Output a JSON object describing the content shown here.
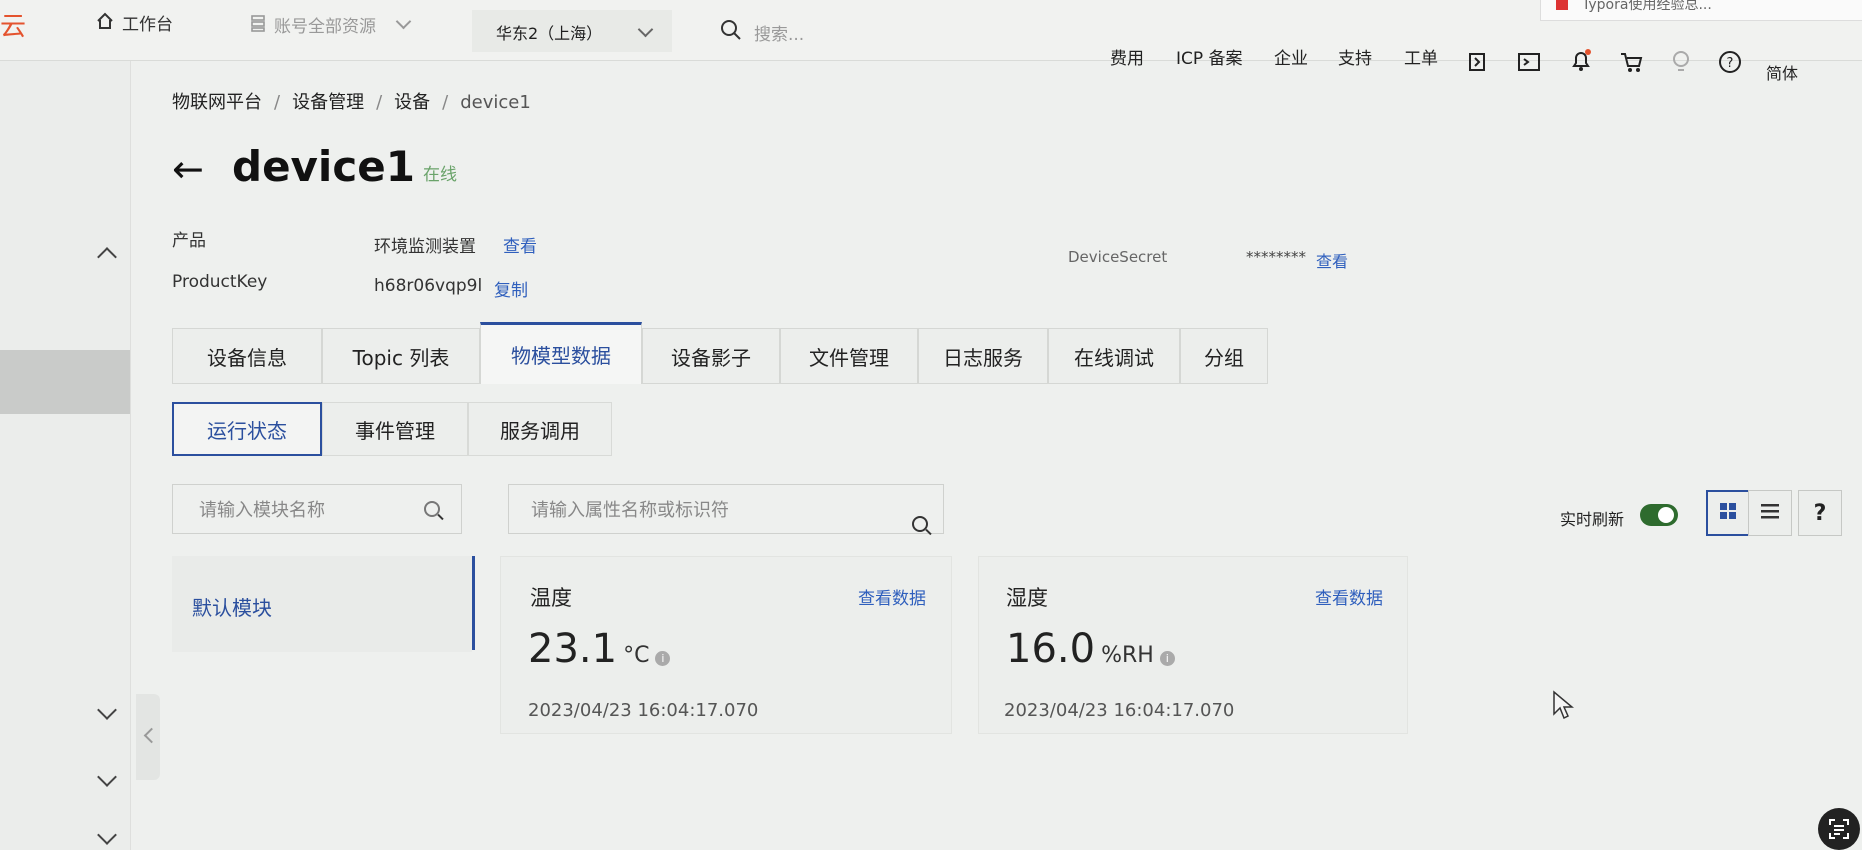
{
  "topbar": {
    "brand": "云",
    "home_label": "工作台",
    "account_scope": "账号全部资源",
    "region": "华东2（上海）",
    "search_placeholder": "搜索...",
    "nav": [
      "费用",
      "ICP 备案",
      "企业",
      "支持",
      "工单"
    ],
    "lang": "简体",
    "background_tab_title": "Typora使用经验总..."
  },
  "breadcrumb": [
    "物联网平台",
    "设备管理",
    "设备",
    "device1"
  ],
  "device": {
    "name": "device1",
    "status": "在线",
    "status_color": "#6aa36a",
    "product_label": "产品",
    "product_value": "环境监测装置",
    "product_link": "查看",
    "productkey_label": "ProductKey",
    "productkey_value": "h68r06vqp9l",
    "productkey_link": "复制",
    "secret_label": "DeviceSecret",
    "secret_value": "********",
    "secret_link": "查看"
  },
  "tabs": [
    "设备信息",
    "Topic 列表",
    "物模型数据",
    "设备影子",
    "文件管理",
    "日志服务",
    "在线调试",
    "分组"
  ],
  "active_tab": "物模型数据",
  "subtabs": [
    "运行状态",
    "事件管理",
    "服务调用"
  ],
  "active_subtab": "运行状态",
  "filters": {
    "module_placeholder": "请输入模块名称",
    "property_placeholder": "请输入属性名称或标识符",
    "realtime_label": "实时刷新",
    "realtime_on": true,
    "help": "?"
  },
  "modules": [
    "默认模块"
  ],
  "properties": [
    {
      "name": "温度",
      "link": "查看数据",
      "value": "23.1",
      "unit": "°C",
      "time": "2023/04/23 16:04:17.070"
    },
    {
      "name": "湿度",
      "link": "查看数据",
      "value": "16.0",
      "unit": "%RH",
      "time": "2023/04/23 16:04:17.070"
    }
  ],
  "colors": {
    "accent": "#2b4f9e",
    "link": "#2f5fbd",
    "brand": "#e4532e"
  }
}
